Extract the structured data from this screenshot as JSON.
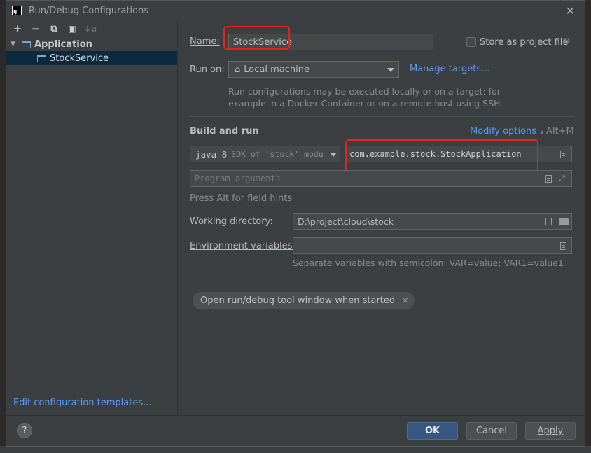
{
  "dialog": {
    "title": "Run/Debug Configurations",
    "app_logo_text": "IJ"
  },
  "left": {
    "toolbar": {
      "add": "+",
      "remove": "−",
      "copy": "⧉",
      "folder": "▣",
      "sort": "↓a"
    },
    "tree": {
      "group_label": "Application",
      "item_label": "StockService"
    },
    "edit_templates_link": "Edit configuration templates..."
  },
  "form": {
    "name_label": "Name:",
    "name_value": "StockService",
    "store_label": "Store as project file",
    "run_on_label": "Run on:",
    "run_on_value": "Local machine",
    "manage_targets": "Manage targets...",
    "run_on_hint_1": "Run configurations may be executed locally or on a target: for",
    "run_on_hint_2": "example in a Docker Container or on a remote host using SSH.",
    "build_run_title": "Build and run",
    "modify_options": "Modify options",
    "modify_shortcut": "Alt+M",
    "jdk_value": "java 8",
    "jdk_detail": "SDK of 'stock' modu",
    "main_class": "com.example.stock.StockApplication",
    "program_args_placeholder": "Program arguments",
    "field_hint": "Press Alt for field hints",
    "working_dir_label": "Working directory:",
    "working_dir_value": "D:\\project\\cloud\\stock",
    "env_label": "Environment variables:",
    "env_value": "",
    "env_hint": "Separate variables with semicolon: VAR=value; VAR1=value1",
    "open_tool_window": "Open run/debug tool window when started"
  },
  "footer": {
    "help": "?",
    "ok": "OK",
    "cancel": "Cancel",
    "apply": "Apply"
  },
  "colors": {
    "dialog_bg": "#3c3f41",
    "selection": "#0d293e",
    "link": "#589df6",
    "highlight_box": "#e5231e",
    "ok_button": "#365880"
  }
}
